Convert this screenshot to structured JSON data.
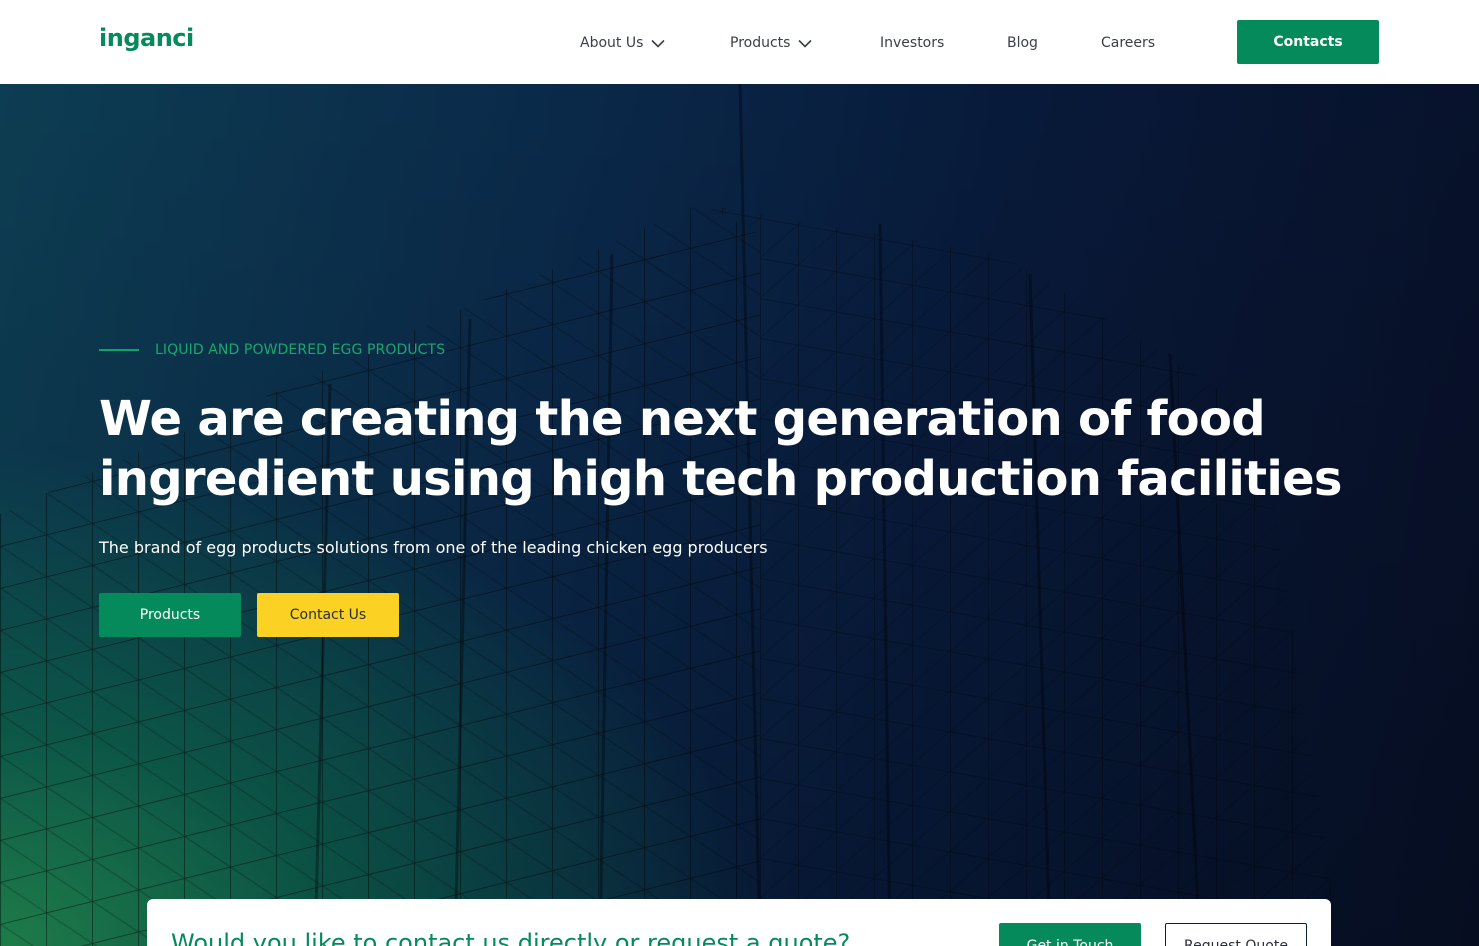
{
  "brand": {
    "logo_text": "inganci",
    "accent_color": "#058a5c",
    "cta_yellow": "#fbd224"
  },
  "nav": {
    "items": [
      {
        "label": "About Us",
        "has_dropdown": true,
        "icon": "chevron-down-icon"
      },
      {
        "label": "Products",
        "has_dropdown": true,
        "icon": "chevron-down-icon"
      },
      {
        "label": "Investors",
        "has_dropdown": false
      },
      {
        "label": "Blog",
        "has_dropdown": false
      },
      {
        "label": "Careers",
        "has_dropdown": false
      }
    ],
    "cta_label": "Contacts"
  },
  "hero": {
    "eyebrow": "LIQUID AND POWDERED EGG PRODUCTS",
    "title_line1": "We are creating the next generation of food",
    "title_line2": "ingredient using high tech production facilities",
    "subtitle": "The brand of egg products solutions from one of the leading chicken egg producers",
    "primary_button": "Products",
    "secondary_button": "Contact Us"
  },
  "quote": {
    "text": "Would you like to contact us directly or request a quote?",
    "primary_button": "Get in Touch",
    "secondary_button": "Request Quote"
  }
}
